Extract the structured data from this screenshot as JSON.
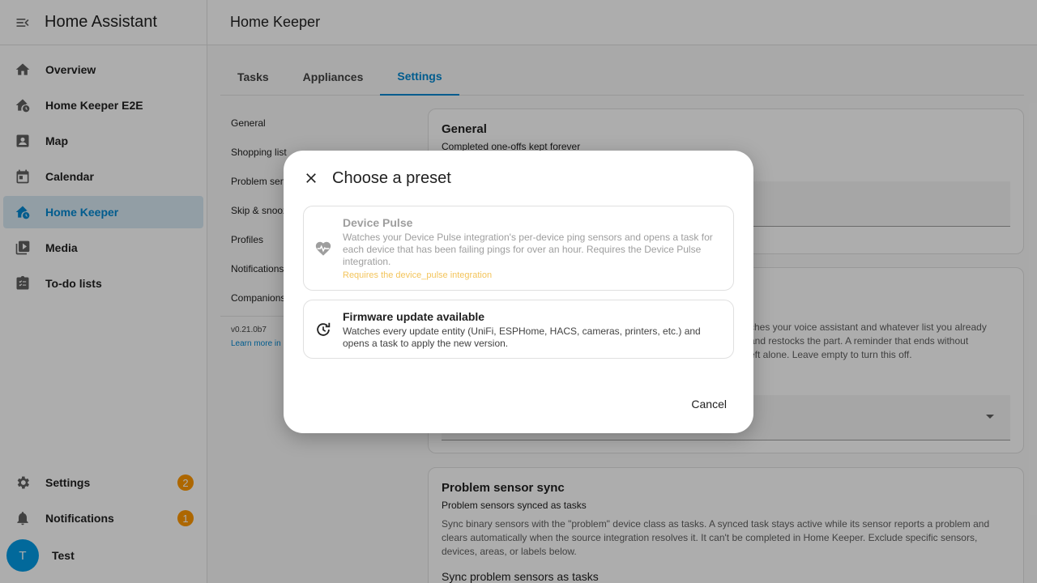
{
  "sidebar": {
    "title": "Home Assistant",
    "items": [
      {
        "label": "Overview",
        "icon": "home-icon"
      },
      {
        "label": "Home Keeper E2E",
        "icon": "home-clock-icon"
      },
      {
        "label": "Map",
        "icon": "map-person-icon"
      },
      {
        "label": "Calendar",
        "icon": "calendar-icon"
      },
      {
        "label": "Home Keeper",
        "icon": "home-clock-icon",
        "active": true
      },
      {
        "label": "Media",
        "icon": "media-icon"
      },
      {
        "label": "To-do lists",
        "icon": "todo-icon"
      }
    ],
    "bottom": {
      "settings_label": "Settings",
      "settings_badge": "2",
      "notifications_label": "Notifications",
      "notifications_badge": "1",
      "user_initial": "T",
      "user_name": "Test"
    }
  },
  "header": {
    "title": "Home Keeper"
  },
  "tabs": [
    {
      "label": "Tasks"
    },
    {
      "label": "Appliances"
    },
    {
      "label": "Settings",
      "active": true
    }
  ],
  "subnav": {
    "items": [
      "General",
      "Shopping list",
      "Problem sensors",
      "Skip & snooze",
      "Profiles",
      "Notifications",
      "Companions"
    ],
    "version": "v0.21.0b7",
    "learn_more": "Learn more in"
  },
  "cards": {
    "general": {
      "title": "General",
      "subtitle": "Completed one-offs kept forever"
    },
    "shopping": {
      "desc_line1": "ches your voice assistant and whatever list you already",
      "desc_line2": "and restocks the part. A reminder that ends without",
      "desc_line3": "eft alone. Leave empty to turn this off."
    },
    "problem": {
      "title": "Problem sensor sync",
      "subtitle": "Problem sensors synced as tasks",
      "desc": "Sync binary sensors with the \"problem\" device class as tasks. A synced task stays active while its sensor reports a problem and clears automatically when the source integration resolves it. It can't be completed in Home Keeper. Exclude specific sensors, devices, areas, or labels below.",
      "sync_label": "Sync problem sensors as tasks"
    }
  },
  "dialog": {
    "title": "Choose a preset",
    "presets": [
      {
        "title": "Device Pulse",
        "desc": "Watches your Device Pulse integration's per-device ping sensors and opens a task for each device that has been failing pings for over an hour. Requires the Device Pulse integration.",
        "warning": "Requires the device_pulse integration",
        "icon": "heart-pulse-icon",
        "disabled": true
      },
      {
        "title": "Firmware update available",
        "desc": "Watches every update entity (UniFi, ESPHome, HACS, cameras, printers, etc.) and opens a task to apply the new version.",
        "icon": "update-icon"
      }
    ],
    "cancel_label": "Cancel"
  },
  "colors": {
    "accent": "#0288d1",
    "badge": "#ff9800",
    "warning_text": "#f3c45b"
  }
}
